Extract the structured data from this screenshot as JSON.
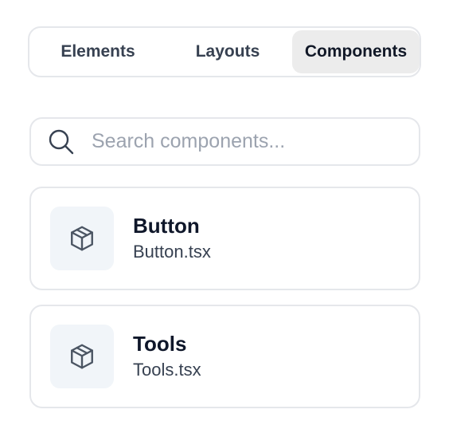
{
  "tabs": {
    "items": [
      {
        "label": "Elements"
      },
      {
        "label": "Layouts"
      },
      {
        "label": "Components"
      }
    ],
    "active": "Components"
  },
  "search": {
    "placeholder": "Search components...",
    "value": ""
  },
  "components": [
    {
      "name": "Button",
      "file": "Button.tsx",
      "icon": "package-icon"
    },
    {
      "name": "Tools",
      "file": "Tools.tsx",
      "icon": "package-icon"
    }
  ],
  "colors": {
    "border": "#e5e7eb",
    "active_tab_bg": "#ececec",
    "icon_tile_bg": "#f1f5f9",
    "title_text": "#0f172a",
    "placeholder_text": "#9ca3af"
  }
}
